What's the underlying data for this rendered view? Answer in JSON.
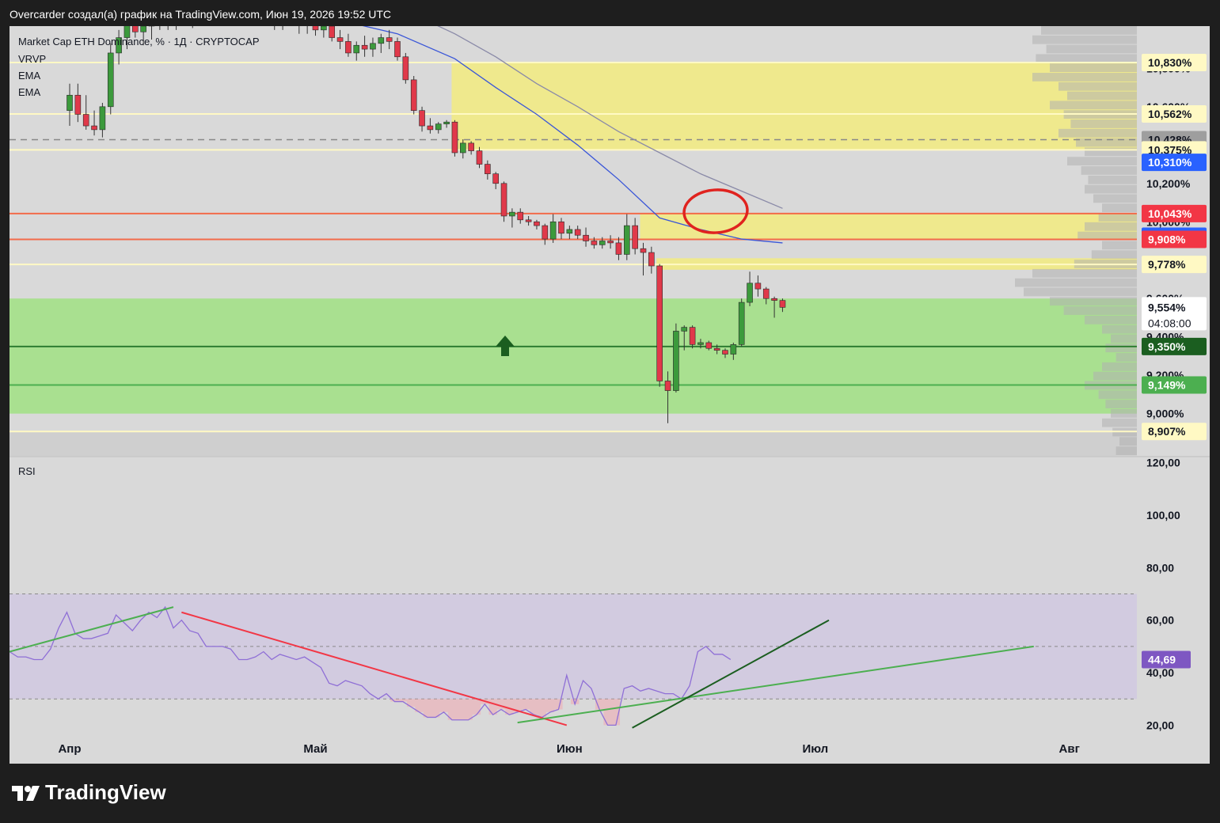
{
  "header": {
    "title": "Overcarder создал(а) график на TradingView.com, Июн 19, 2026 19:52 UTC"
  },
  "legend": {
    "symbol": "Market Cap ETH Dominance, % · 1Д · CRYPTOCAP",
    "indicators": [
      "VRVP",
      "EMA",
      "EMA"
    ],
    "rsi_title": "RSI"
  },
  "brand": {
    "name": "TradingView"
  },
  "colors": {
    "background": "#d9d9d9",
    "up": "#3c9a3c",
    "down": "#e0394a",
    "yellow_zone": "#f2eb7f",
    "green_zone": "#a6e08c",
    "ema_fast": "#3a56d8",
    "ema_slow": "#8a8aa8",
    "rsi_line": "#8f6fd6",
    "rsi_band": "#d2cbe0",
    "label_blue": "#2962ff",
    "label_red": "#f23645",
    "label_green": "#4caf50",
    "label_darkgreen": "#1b5e20",
    "label_grey": "#9e9e9e",
    "label_pale": "#fff9c4",
    "label_purple": "#7e57c2"
  },
  "chart_data": [
    {
      "type": "candlestick",
      "title": "Market Cap ETH Dominance, % · 1Д · CRYPTOCAP",
      "ylim": [
        8.78,
        11.02
      ],
      "x_ticks": [
        {
          "label": "Апр",
          "index": 0
        },
        {
          "label": "Май",
          "index": 30
        },
        {
          "label": "Июн",
          "index": 61
        },
        {
          "label": "Июл",
          "index": 91
        },
        {
          "label": "Авг",
          "index": 122
        }
      ],
      "y_ticks": [
        "9,000%",
        "9,200%",
        "9,400%",
        "9,600%",
        "9,800%",
        "10,000%",
        "10,200%",
        "10,400%",
        "10,600%",
        "10,800%"
      ],
      "price_labels": [
        {
          "text": "10,830%",
          "value": 10.83,
          "style": "pale"
        },
        {
          "text": "10,562%",
          "value": 10.562,
          "style": "pale"
        },
        {
          "text": "10,428%",
          "value": 10.428,
          "style": "grey"
        },
        {
          "text": "10,375%",
          "value": 10.375,
          "style": "pale"
        },
        {
          "text": "10,310%",
          "value": 10.31,
          "style": "blue"
        },
        {
          "text": "10,043%",
          "value": 10.043,
          "style": "red"
        },
        {
          "text": "9,925%",
          "value": 9.925,
          "style": "blue"
        },
        {
          "text": "9,908%",
          "value": 9.908,
          "style": "red"
        },
        {
          "text": "9,778%",
          "value": 9.778,
          "style": "pale"
        },
        {
          "text": "9,554%",
          "value": 9.554,
          "style": "white",
          "countdown": "04:08:00"
        },
        {
          "text": "9,350%",
          "value": 9.35,
          "style": "darkgreen"
        },
        {
          "text": "9,149%",
          "value": 9.149,
          "style": "green"
        },
        {
          "text": "8,907%",
          "value": 8.907,
          "style": "pale"
        }
      ],
      "zones": [
        {
          "type": "yellow",
          "from_index": 47,
          "y_low": 10.375,
          "y_high": 10.83
        },
        {
          "type": "yellow",
          "from_index": 70,
          "y_low": 9.908,
          "y_high": 10.043
        },
        {
          "type": "yellow",
          "from_index": 72,
          "y_low": 9.75,
          "y_high": 9.81
        },
        {
          "type": "green",
          "from_index": 0,
          "y_low": 9.0,
          "y_high": 9.6
        }
      ],
      "horizontal_lines": [
        {
          "value": 10.83,
          "color": "#fff9c4"
        },
        {
          "value": 10.562,
          "color": "#fff9c4"
        },
        {
          "value": 10.428,
          "color": "#888888",
          "dashed": true
        },
        {
          "value": 10.375,
          "color": "#fff9c4"
        },
        {
          "value": 10.043,
          "color": "#f26b4a"
        },
        {
          "value": 9.908,
          "color": "#f26b4a"
        },
        {
          "value": 9.778,
          "color": "#fff9c4"
        },
        {
          "value": 9.35,
          "color": "#2e7d32"
        },
        {
          "value": 9.149,
          "color": "#4caf50"
        },
        {
          "value": 8.907,
          "color": "#fff9c4"
        }
      ],
      "candles": [
        {
          "o": 10.58,
          "h": 10.72,
          "l": 10.5,
          "c": 10.66
        },
        {
          "o": 10.66,
          "h": 10.72,
          "l": 10.52,
          "c": 10.56
        },
        {
          "o": 10.56,
          "h": 10.66,
          "l": 10.48,
          "c": 10.5
        },
        {
          "o": 10.5,
          "h": 10.58,
          "l": 10.45,
          "c": 10.48
        },
        {
          "o": 10.48,
          "h": 10.62,
          "l": 10.44,
          "c": 10.6
        },
        {
          "o": 10.6,
          "h": 10.93,
          "l": 10.56,
          "c": 10.88
        },
        {
          "o": 10.88,
          "h": 11.0,
          "l": 10.82,
          "c": 10.96
        },
        {
          "o": 10.96,
          "h": 11.05,
          "l": 10.9,
          "c": 11.03
        },
        {
          "o": 11.03,
          "h": 11.06,
          "l": 10.96,
          "c": 10.99
        },
        {
          "o": 10.99,
          "h": 11.05,
          "l": 10.92,
          "c": 11.02
        },
        {
          "o": 11.02,
          "h": 11.08,
          "l": 10.95,
          "c": 11.05
        },
        {
          "o": 11.05,
          "h": 11.1,
          "l": 11.0,
          "c": 11.07
        },
        {
          "o": 11.07,
          "h": 11.1,
          "l": 11.0,
          "c": 11.04
        },
        {
          "o": 11.04,
          "h": 11.1,
          "l": 11.0,
          "c": 11.08
        },
        {
          "o": 11.08,
          "h": 11.12,
          "l": 11.02,
          "c": 11.06
        },
        {
          "o": 11.06,
          "h": 11.12,
          "l": 11.01,
          "c": 11.1
        },
        {
          "o": 11.1,
          "h": 11.14,
          "l": 11.04,
          "c": 11.08
        },
        {
          "o": 11.08,
          "h": 11.14,
          "l": 11.03,
          "c": 11.12
        },
        {
          "o": 11.12,
          "h": 11.16,
          "l": 11.06,
          "c": 11.1
        },
        {
          "o": 11.1,
          "h": 11.15,
          "l": 11.04,
          "c": 11.13
        },
        {
          "o": 11.13,
          "h": 11.16,
          "l": 11.06,
          "c": 11.09
        },
        {
          "o": 11.09,
          "h": 11.14,
          "l": 11.03,
          "c": 11.12
        },
        {
          "o": 11.12,
          "h": 11.16,
          "l": 11.06,
          "c": 11.1
        },
        {
          "o": 11.1,
          "h": 11.14,
          "l": 11.04,
          "c": 11.07
        },
        {
          "o": 11.07,
          "h": 11.12,
          "l": 11.02,
          "c": 11.1
        },
        {
          "o": 11.1,
          "h": 11.12,
          "l": 11.0,
          "c": 11.05
        },
        {
          "o": 11.05,
          "h": 11.1,
          "l": 11.0,
          "c": 11.08
        },
        {
          "o": 11.08,
          "h": 11.12,
          "l": 11.02,
          "c": 11.05
        },
        {
          "o": 11.05,
          "h": 11.08,
          "l": 10.98,
          "c": 11.03
        },
        {
          "o": 11.03,
          "h": 11.06,
          "l": 10.98,
          "c": 11.05
        },
        {
          "o": 11.05,
          "h": 11.07,
          "l": 10.97,
          "c": 11.0
        },
        {
          "o": 11.0,
          "h": 11.04,
          "l": 10.96,
          "c": 11.02
        },
        {
          "o": 11.02,
          "h": 11.05,
          "l": 10.94,
          "c": 10.96
        },
        {
          "o": 10.96,
          "h": 11.0,
          "l": 10.9,
          "c": 10.94
        },
        {
          "o": 10.94,
          "h": 10.98,
          "l": 10.86,
          "c": 10.88
        },
        {
          "o": 10.88,
          "h": 10.94,
          "l": 10.84,
          "c": 10.92
        },
        {
          "o": 10.92,
          "h": 10.97,
          "l": 10.86,
          "c": 10.9
        },
        {
          "o": 10.9,
          "h": 10.96,
          "l": 10.86,
          "c": 10.93
        },
        {
          "o": 10.93,
          "h": 10.98,
          "l": 10.88,
          "c": 10.96
        },
        {
          "o": 10.96,
          "h": 11.0,
          "l": 10.9,
          "c": 10.94
        },
        {
          "o": 10.94,
          "h": 10.96,
          "l": 10.84,
          "c": 10.86
        },
        {
          "o": 10.86,
          "h": 10.88,
          "l": 10.72,
          "c": 10.74
        },
        {
          "o": 10.74,
          "h": 10.76,
          "l": 10.56,
          "c": 10.58
        },
        {
          "o": 10.58,
          "h": 10.6,
          "l": 10.47,
          "c": 10.5
        },
        {
          "o": 10.5,
          "h": 10.54,
          "l": 10.46,
          "c": 10.48
        },
        {
          "o": 10.48,
          "h": 10.52,
          "l": 10.46,
          "c": 10.51
        },
        {
          "o": 10.51,
          "h": 10.53,
          "l": 10.49,
          "c": 10.52
        },
        {
          "o": 10.52,
          "h": 10.53,
          "l": 10.34,
          "c": 10.36
        },
        {
          "o": 10.36,
          "h": 10.43,
          "l": 10.33,
          "c": 10.41
        },
        {
          "o": 10.41,
          "h": 10.42,
          "l": 10.35,
          "c": 10.37
        },
        {
          "o": 10.37,
          "h": 10.39,
          "l": 10.28,
          "c": 10.3
        },
        {
          "o": 10.3,
          "h": 10.32,
          "l": 10.22,
          "c": 10.25
        },
        {
          "o": 10.25,
          "h": 10.26,
          "l": 10.17,
          "c": 10.2
        },
        {
          "o": 10.2,
          "h": 10.21,
          "l": 10.0,
          "c": 10.03
        },
        {
          "o": 10.03,
          "h": 10.07,
          "l": 9.97,
          "c": 10.05
        },
        {
          "o": 10.05,
          "h": 10.07,
          "l": 9.99,
          "c": 10.01
        },
        {
          "o": 10.01,
          "h": 10.03,
          "l": 9.98,
          "c": 10.0
        },
        {
          "o": 10.0,
          "h": 10.01,
          "l": 9.96,
          "c": 9.98
        },
        {
          "o": 9.98,
          "h": 9.99,
          "l": 9.88,
          "c": 9.91
        },
        {
          "o": 9.91,
          "h": 10.04,
          "l": 9.89,
          "c": 10.0
        },
        {
          "o": 10.0,
          "h": 10.02,
          "l": 9.91,
          "c": 9.94
        },
        {
          "o": 9.94,
          "h": 9.98,
          "l": 9.91,
          "c": 9.96
        },
        {
          "o": 9.96,
          "h": 9.98,
          "l": 9.91,
          "c": 9.93
        },
        {
          "o": 9.93,
          "h": 9.97,
          "l": 9.87,
          "c": 9.9
        },
        {
          "o": 9.9,
          "h": 9.92,
          "l": 9.86,
          "c": 9.88
        },
        {
          "o": 9.88,
          "h": 9.92,
          "l": 9.86,
          "c": 9.9
        },
        {
          "o": 9.9,
          "h": 9.93,
          "l": 9.86,
          "c": 9.89
        },
        {
          "o": 9.89,
          "h": 9.92,
          "l": 9.8,
          "c": 9.83
        },
        {
          "o": 9.83,
          "h": 10.04,
          "l": 9.8,
          "c": 9.98
        },
        {
          "o": 9.98,
          "h": 10.02,
          "l": 9.83,
          "c": 9.86
        },
        {
          "o": 9.86,
          "h": 9.89,
          "l": 9.72,
          "c": 9.84
        },
        {
          "o": 9.84,
          "h": 9.87,
          "l": 9.73,
          "c": 9.77
        },
        {
          "o": 9.77,
          "h": 9.78,
          "l": 9.14,
          "c": 9.17
        },
        {
          "o": 9.17,
          "h": 9.22,
          "l": 8.95,
          "c": 9.12
        },
        {
          "o": 9.12,
          "h": 9.47,
          "l": 9.11,
          "c": 9.43
        },
        {
          "o": 9.43,
          "h": 9.46,
          "l": 9.33,
          "c": 9.45
        },
        {
          "o": 9.45,
          "h": 9.46,
          "l": 9.34,
          "c": 9.36
        },
        {
          "o": 9.36,
          "h": 9.39,
          "l": 9.34,
          "c": 9.37
        },
        {
          "o": 9.37,
          "h": 9.38,
          "l": 9.33,
          "c": 9.34
        },
        {
          "o": 9.34,
          "h": 9.36,
          "l": 9.31,
          "c": 9.33
        },
        {
          "o": 9.33,
          "h": 9.34,
          "l": 9.29,
          "c": 9.31
        },
        {
          "o": 9.31,
          "h": 9.37,
          "l": 9.28,
          "c": 9.36
        },
        {
          "o": 9.36,
          "h": 9.6,
          "l": 9.35,
          "c": 9.58
        },
        {
          "o": 9.58,
          "h": 9.74,
          "l": 9.56,
          "c": 9.68
        },
        {
          "o": 9.68,
          "h": 9.72,
          "l": 9.61,
          "c": 9.65
        },
        {
          "o": 9.65,
          "h": 9.66,
          "l": 9.57,
          "c": 9.6
        },
        {
          "o": 9.6,
          "h": 9.61,
          "l": 9.5,
          "c": 9.59
        },
        {
          "o": 9.59,
          "h": 9.6,
          "l": 9.53,
          "c": 9.554
        }
      ],
      "ema_fast": [
        [
          0,
          11.2
        ],
        [
          10,
          11.16
        ],
        [
          20,
          11.13
        ],
        [
          30,
          11.08
        ],
        [
          40,
          10.98
        ],
        [
          47,
          10.85
        ],
        [
          52,
          10.7
        ],
        [
          57,
          10.56
        ],
        [
          62,
          10.4
        ],
        [
          67,
          10.22
        ],
        [
          72,
          10.02
        ],
        [
          77,
          9.96
        ],
        [
          82,
          9.91
        ],
        [
          87,
          9.89
        ]
      ],
      "ema_slow": [
        [
          40,
          11.12
        ],
        [
          47,
          10.98
        ],
        [
          52,
          10.86
        ],
        [
          57,
          10.72
        ],
        [
          62,
          10.6
        ],
        [
          67,
          10.47
        ],
        [
          72,
          10.36
        ],
        [
          77,
          10.25
        ],
        [
          82,
          10.16
        ],
        [
          87,
          10.07
        ]
      ],
      "volume_profile": [
        0.55,
        0.6,
        0.52,
        0.58,
        0.5,
        0.6,
        0.45,
        0.4,
        0.5,
        0.42,
        0.38,
        0.45,
        0.35,
        0.3,
        0.4,
        0.32,
        0.28,
        0.3,
        0.25,
        0.2,
        0.22,
        0.3,
        0.34,
        0.2,
        0.26,
        0.36,
        0.6,
        0.7,
        0.65,
        0.5,
        0.42,
        0.3,
        0.2,
        0.15,
        0.18,
        0.12,
        0.2,
        0.25,
        0.3,
        0.22,
        0.18,
        0.15,
        0.2,
        0.14,
        0.1,
        0.12
      ]
    },
    {
      "type": "line",
      "title": "RSI",
      "ylim": [
        15,
        122
      ],
      "y_ticks": [
        "20,00",
        "40,00",
        "60,00",
        "80,00",
        "100,00",
        "120,00"
      ],
      "bands": {
        "upper": 70,
        "middle": 50,
        "lower": 30
      },
      "last_value_label": "44,69",
      "values": [
        48,
        46,
        46,
        45,
        45,
        49,
        57,
        63,
        55,
        53,
        53,
        54,
        55,
        62,
        59,
        56,
        60,
        63,
        61,
        65,
        57,
        60,
        56,
        55,
        50,
        50,
        50,
        49,
        45,
        45,
        46,
        48,
        45,
        47,
        46,
        45,
        46,
        44,
        42,
        36,
        35,
        37,
        36,
        35,
        32,
        30,
        32,
        29,
        29,
        27,
        25,
        23,
        23,
        25,
        22,
        22,
        22,
        24,
        28,
        24,
        26,
        24,
        25,
        26,
        24,
        23,
        25,
        26,
        39,
        28,
        37,
        34,
        26,
        20,
        20,
        34,
        35,
        33,
        34,
        33,
        32,
        32,
        30,
        35,
        48,
        50,
        47,
        47,
        45
      ],
      "trendlines": [
        {
          "from": [
            0,
            48
          ],
          "to": [
            20,
            65
          ],
          "color": "#4caf50"
        },
        {
          "from": [
            21,
            63
          ],
          "to": [
            68,
            20
          ],
          "color": "#f23645"
        },
        {
          "from": [
            62,
            21
          ],
          "to": [
            125,
            50
          ],
          "color": "#4caf50"
        },
        {
          "from": [
            76,
            19
          ],
          "to": [
            100,
            60
          ],
          "color": "#1b5e20"
        }
      ]
    }
  ]
}
